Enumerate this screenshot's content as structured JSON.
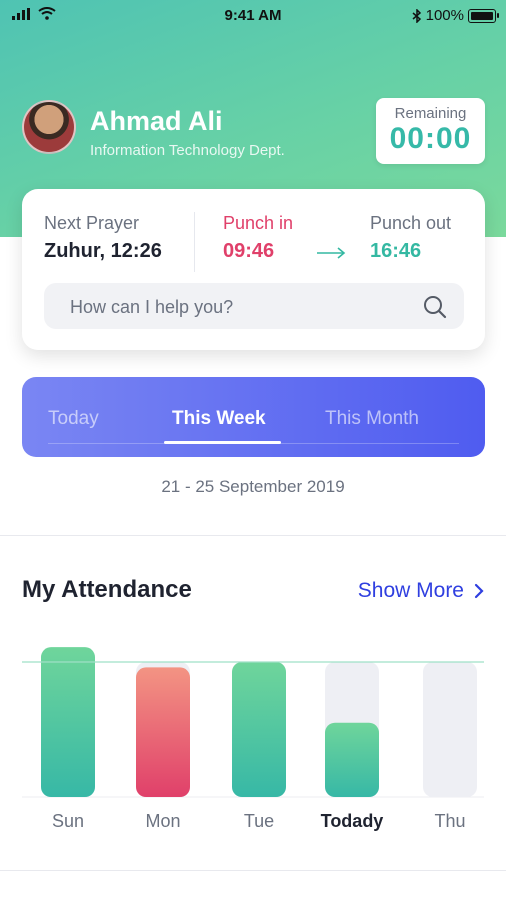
{
  "status_bar": {
    "time": "9:41 AM",
    "battery": "100%"
  },
  "user": {
    "name": "Ahmad Ali",
    "department": "Information Technology Dept."
  },
  "remaining": {
    "label": "Remaining",
    "value": "00:00"
  },
  "card": {
    "next_prayer_label": "Next Prayer",
    "next_prayer_value": "Zuhur, 12:26",
    "punch_in_label": "Punch in",
    "punch_in_value": "09:46",
    "punch_out_label": "Punch out",
    "punch_out_value": "16:46",
    "search_placeholder": "How can I help you?"
  },
  "tabs": [
    {
      "label": "Today",
      "active": false
    },
    {
      "label": "This Week",
      "active": true
    },
    {
      "label": "This Month",
      "active": false
    }
  ],
  "date_range": "21 - 25 September 2019",
  "attendance": {
    "title": "My Attendance",
    "show_more": "Show More"
  },
  "chart_data": {
    "type": "bar",
    "categories": [
      "Sun",
      "Mon",
      "Tue",
      "Todady",
      "Thu"
    ],
    "values": [
      1.11,
      0.96,
      1.0,
      0.55,
      0
    ],
    "target": 1.0,
    "highlight_category": "Todady",
    "colors": {
      "Sun": "teal-green",
      "Mon": "pink-red",
      "Tue": "teal-green",
      "Todady": "teal-green",
      "Thu": "track-only"
    },
    "track_color": "#eeeff4",
    "green_gradient": [
      "#6fd59b",
      "#37b8a6"
    ],
    "red_gradient": [
      "#f39483",
      "#e0406a"
    ],
    "target_line_color": "#9fe0c6",
    "grid": false,
    "legend": "none"
  }
}
